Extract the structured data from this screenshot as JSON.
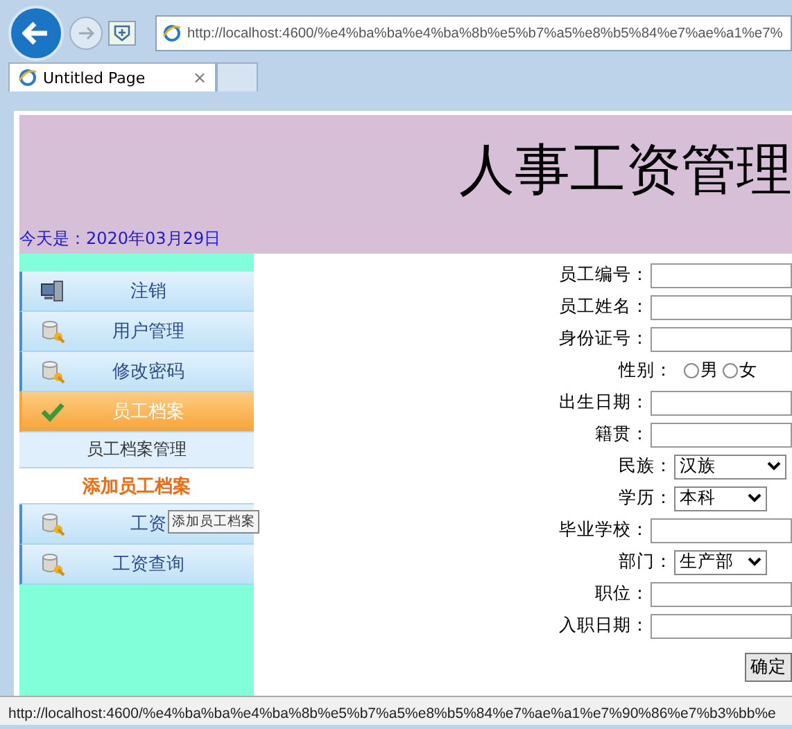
{
  "browser": {
    "address": "http://localhost:4600/%e4%ba%ba%e4%ba%8b%e5%b7%a5%e8%b5%84%e7%ae%a1%e7%",
    "tab": {
      "title": "Untitled Page",
      "close": "×",
      "selected": true
    }
  },
  "header": {
    "title": "人事工资管理",
    "date": "今天是：2020年03月29日"
  },
  "menu": [
    {
      "kind": "exit",
      "label": "注销",
      "selected": false
    },
    {
      "kind": "item",
      "label": "用户管理",
      "selected": false
    },
    {
      "kind": "item",
      "label": "修改密码",
      "selected": false
    },
    {
      "kind": "item",
      "label": "员工档案",
      "selected": true
    },
    {
      "kind": "sub",
      "label": "员工档案管理",
      "selected": false
    },
    {
      "kind": "sub",
      "label": "添加员工档案",
      "selected": true
    },
    {
      "kind": "item",
      "label": "工资",
      "selected": false,
      "tooltip": "添加员工档案"
    },
    {
      "kind": "item",
      "label": "工资查询",
      "selected": false
    }
  ],
  "form": {
    "fields": [
      {
        "kind": "text",
        "label": "员工编号："
      },
      {
        "kind": "text",
        "label": "员工姓名："
      },
      {
        "kind": "text",
        "label": "身份证号："
      },
      {
        "kind": "radio",
        "label": "性别：",
        "options": [
          {
            "label": "男",
            "checked": false
          },
          {
            "label": "女",
            "checked": false
          }
        ]
      },
      {
        "kind": "text",
        "label": "出生日期："
      },
      {
        "kind": "text",
        "label": "籍贯："
      },
      {
        "kind": "select",
        "label": "民族：",
        "value": "汉族",
        "wide": true
      },
      {
        "kind": "select",
        "label": "学历：",
        "value": "本科",
        "wide": false
      },
      {
        "kind": "text",
        "label": "毕业学校："
      },
      {
        "kind": "select",
        "label": "部门：",
        "value": "生产部",
        "wide": false
      },
      {
        "kind": "text",
        "label": "职位："
      },
      {
        "kind": "text",
        "label": "入职日期："
      }
    ],
    "submit": "确定"
  },
  "status_bar": {
    "text": "http://localhost:4600/%e4%ba%ba%e4%ba%8b%e5%b7%a5%e8%b5%84%e7%ae%a1%e7%90%86%e7%b3%bb%e"
  }
}
